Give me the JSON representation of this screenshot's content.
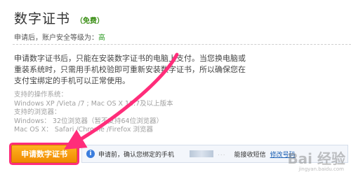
{
  "header": {
    "title": "数字证书",
    "badge": "（免费）"
  },
  "security": {
    "prefix": "申请后，账户安全等级为：",
    "level": "高"
  },
  "description": "申请数字证书后，只能在安装数字证书的电脑上支付。当您换电脑或重装系统时，只需用手机校验即可重新安装数字证书，所以确保您在支付宝绑定的手机可以正常使用。",
  "systems": {
    "os_label": "支持的操作系统：",
    "os_value": "Windows XP /Vieta /7 ; Mac OS X 10.7及以上版本",
    "browser_label": "支持的浏览器：",
    "windows_browsers": "Windows： 32位浏览器（暂不支持64位浏览器）",
    "mac_browsers": "Mac OS X： Safari /Chrome /Firefox 浏览器"
  },
  "apply_button": "申请数字证书",
  "notice": {
    "icon": "i",
    "text": "申请前，确认您绑定的手机",
    "masked": "...",
    "sms": "能接收短信",
    "modify_link": "修改号码"
  },
  "watermark": {
    "main": "Bai 经验",
    "sub": "jingyan.baidu.com"
  },
  "colors": {
    "arrow": "#ff2d7a",
    "button": "#f39800",
    "level": "#2e9b24",
    "badge": "#3a8e14"
  }
}
